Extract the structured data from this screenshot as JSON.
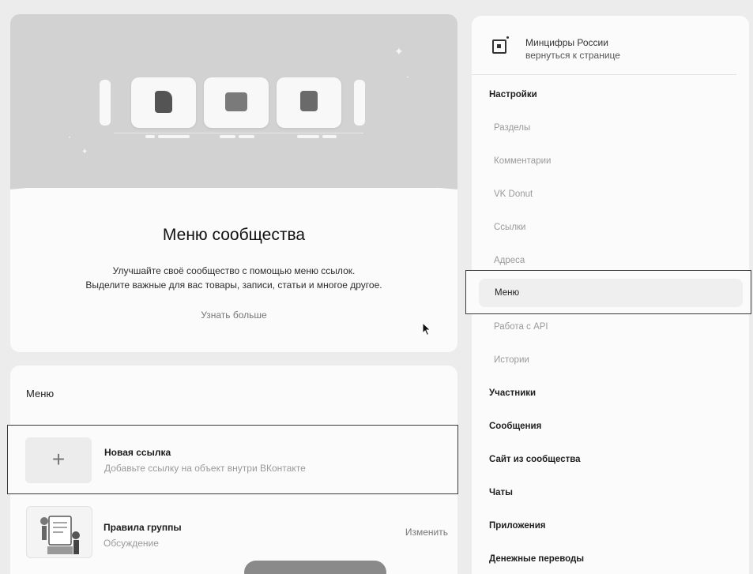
{
  "hero": {
    "title": "Меню сообщества",
    "description_line1": "Улучшайте своё сообщество с помощью меню ссылок.",
    "description_line2": "Выделите важные для вас товары, записи, статьи и многое другое.",
    "learn_more": "Узнать больше",
    "icons": [
      "document-icon",
      "image-icon",
      "grid-icon"
    ]
  },
  "menu": {
    "title": "Меню",
    "new_link": {
      "title": "Новая ссылка",
      "subtitle": "Добавьте ссылку на объект внутри ВКонтакте",
      "icon": "plus-icon"
    },
    "items": [
      {
        "title": "Правила группы",
        "subtitle": "Обсуждение",
        "action": "Изменить"
      }
    ]
  },
  "sidebar": {
    "community_name": "Минцифры России",
    "back_link": "вернуться к странице",
    "items": [
      {
        "label": "Настройки",
        "kind": "section"
      },
      {
        "label": "Разделы",
        "kind": "sub"
      },
      {
        "label": "Комментарии",
        "kind": "sub"
      },
      {
        "label": "VK Donut",
        "kind": "sub"
      },
      {
        "label": "Ссылки",
        "kind": "sub"
      },
      {
        "label": "Адреса",
        "kind": "sub"
      },
      {
        "label": "Меню",
        "kind": "active"
      },
      {
        "label": "Работа с API",
        "kind": "sub"
      },
      {
        "label": "Истории",
        "kind": "sub"
      },
      {
        "label": "Участники",
        "kind": "section"
      },
      {
        "label": "Сообщения",
        "kind": "section"
      },
      {
        "label": "Сайт из сообщества",
        "kind": "section"
      },
      {
        "label": "Чаты",
        "kind": "section"
      },
      {
        "label": "Приложения",
        "kind": "section"
      },
      {
        "label": "Денежные переводы",
        "kind": "section"
      }
    ]
  }
}
